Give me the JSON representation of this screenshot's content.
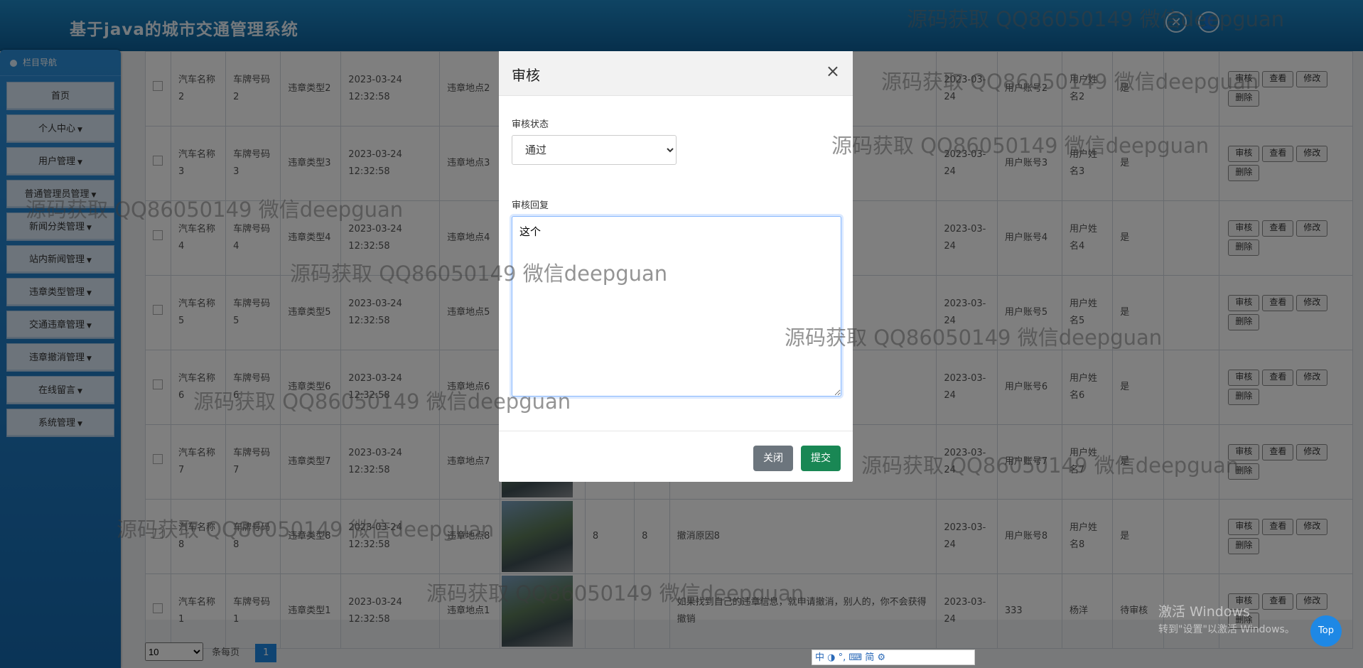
{
  "header": {
    "title": "基于java的城市交通管理系统"
  },
  "sidebar": {
    "title": "栏目导航",
    "items": [
      {
        "label": "首页",
        "dropdown": false
      },
      {
        "label": "个人中心",
        "dropdown": true
      },
      {
        "label": "用户管理",
        "dropdown": true
      },
      {
        "label": "普通管理员管理",
        "dropdown": true
      },
      {
        "label": "新闻分类管理",
        "dropdown": true
      },
      {
        "label": "站内新闻管理",
        "dropdown": true
      },
      {
        "label": "违章类型管理",
        "dropdown": true
      },
      {
        "label": "交通违章管理",
        "dropdown": true
      },
      {
        "label": "违章撤消管理",
        "dropdown": true
      },
      {
        "label": "在线留言",
        "dropdown": true
      },
      {
        "label": "系统管理",
        "dropdown": true
      }
    ]
  },
  "table": {
    "ops": {
      "audit": "审核",
      "view": "查看",
      "edit": "修改",
      "delete": "删除"
    },
    "rows": [
      {
        "car": "汽车名称2",
        "plate": "车牌号码2",
        "type": "违章类型2",
        "time": "2023-03-24 12:32:58",
        "place": "违章地点2",
        "n1": "",
        "n2": "",
        "reason": "",
        "date": "2023-03-24",
        "account": "用户账号2",
        "name": "用户姓名2",
        "status": "是"
      },
      {
        "car": "汽车名称3",
        "plate": "车牌号码3",
        "type": "违章类型3",
        "time": "2023-03-24 12:32:58",
        "place": "违章地点3",
        "n1": "",
        "n2": "",
        "reason": "",
        "date": "2023-03-24",
        "account": "用户账号3",
        "name": "用户姓名3",
        "status": "是"
      },
      {
        "car": "汽车名称4",
        "plate": "车牌号码4",
        "type": "违章类型4",
        "time": "2023-03-24 12:32:58",
        "place": "违章地点4",
        "n1": "",
        "n2": "",
        "reason": "",
        "date": "2023-03-24",
        "account": "用户账号4",
        "name": "用户姓名4",
        "status": "是"
      },
      {
        "car": "汽车名称5",
        "plate": "车牌号码5",
        "type": "违章类型5",
        "time": "2023-03-24 12:32:58",
        "place": "违章地点5",
        "n1": "",
        "n2": "",
        "reason": "",
        "date": "2023-03-24",
        "account": "用户账号5",
        "name": "用户姓名5",
        "status": "是"
      },
      {
        "car": "汽车名称6",
        "plate": "车牌号码6",
        "type": "违章类型6",
        "time": "2023-03-24 12:32:58",
        "place": "违章地点6",
        "n1": "",
        "n2": "",
        "reason": "",
        "date": "2023-03-24",
        "account": "用户账号6",
        "name": "用户姓名6",
        "status": "是"
      },
      {
        "car": "汽车名称7",
        "plate": "车牌号码7",
        "type": "违章类型7",
        "time": "2023-03-24 12:32:58",
        "place": "违章地点7",
        "n1": "",
        "n2": "",
        "reason": "",
        "date": "2023-03-24",
        "account": "用户账号7",
        "name": "用户姓名7",
        "status": "是"
      },
      {
        "car": "汽车名称8",
        "plate": "车牌号码8",
        "type": "违章类型8",
        "time": "2023-03-24 12:32:58",
        "place": "违章地点8",
        "n1": "8",
        "n2": "8",
        "reason": "撤消原因8",
        "date": "2023-03-24",
        "account": "用户账号8",
        "name": "用户姓名8",
        "status": "是"
      },
      {
        "car": "汽车名称1",
        "plate": "车牌号码1",
        "type": "违章类型1",
        "time": "2023-03-24 12:32:58",
        "place": "违章地点1",
        "n1": "",
        "n2": "",
        "reason": "如果找到自己的违章信息，就申请撤消，别人的，你不会获得撤销",
        "date": "2023-03-24",
        "account": "333",
        "name": "杨洋",
        "status": "待审核"
      }
    ]
  },
  "pager": {
    "size": "10",
    "per_page_label": "条每页",
    "current": "1"
  },
  "modal": {
    "title": "审核",
    "close_symbol": "×",
    "status_label": "审核状态",
    "status_value": "通过",
    "reply_label": "审核回复",
    "reply_value": "这个",
    "close_button": "关闭",
    "submit_button": "提交"
  },
  "watermark": "源码获取 QQ86050149 微信deepguan",
  "windows_activation": {
    "line1": "激活 Windows",
    "line2": "转到\"设置\"以激活 Windows。"
  },
  "top_button": "Top",
  "ime_toolbar": "中 ◑ °, ⌨ 简 ⚙"
}
